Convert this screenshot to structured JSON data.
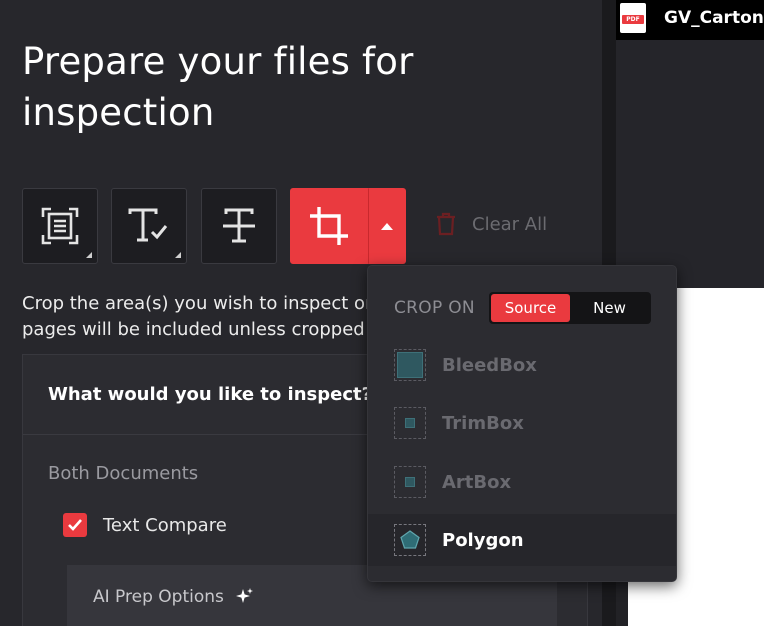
{
  "title": "Prepare your files for inspection",
  "toolbar": {
    "tools": [
      {
        "name": "select-area-tool",
        "icon": "scan-frame-icon"
      },
      {
        "name": "text-check-tool",
        "icon": "text-check-icon"
      },
      {
        "name": "strikethrough-tool",
        "icon": "strikethrough-icon"
      },
      {
        "name": "crop-tool",
        "icon": "crop-icon",
        "active": true
      }
    ],
    "clear_all_label": "Clear All"
  },
  "instructions": {
    "line1": "Crop the area(s) you wish to inspect on",
    "line2": "pages will be included unless cropped o"
  },
  "inspect": {
    "header": "What would you like to inspect?",
    "section_label": "Both Documents",
    "text_compare_label": "Text Compare",
    "text_compare_checked": true,
    "ai_prep_label": "AI Prep Options"
  },
  "document": {
    "filename": "GV_Carton",
    "badge": "PDF"
  },
  "crop_menu": {
    "crop_on_label": "CROP ON",
    "toggle": {
      "source_label": "Source",
      "new_label": "New",
      "selected": "Source"
    },
    "options": [
      {
        "label": "BleedBox",
        "enabled": false
      },
      {
        "label": "TrimBox",
        "enabled": false
      },
      {
        "label": "ArtBox",
        "enabled": false
      },
      {
        "label": "Polygon",
        "enabled": true,
        "selected": true
      }
    ]
  },
  "colors": {
    "accent": "#ea3a3f",
    "panel": "#27272c",
    "menu": "#2c2c31"
  }
}
